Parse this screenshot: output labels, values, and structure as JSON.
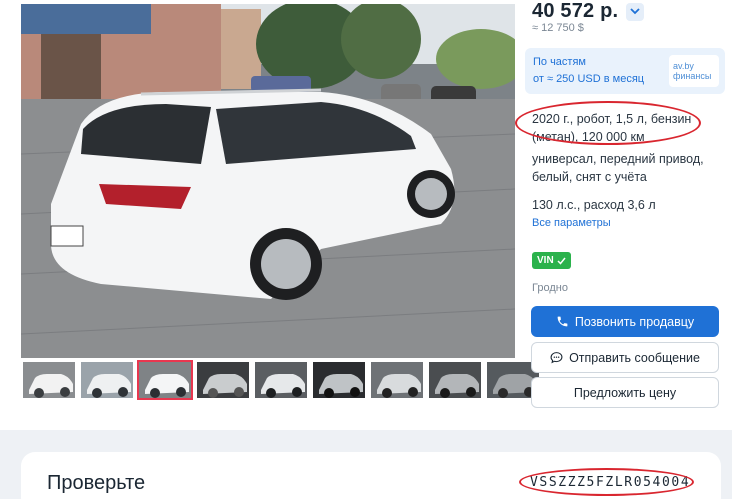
{
  "listing": {
    "price": "40 572 р.",
    "price_usd": "≈ 12 750 $",
    "finance": {
      "title": "По частям",
      "subtitle": "от ≈ 250 USD в месяц",
      "logo_line1": "av.by",
      "logo_line2": "финансы"
    },
    "specs": {
      "main": "2020 г., робот, 1,5 л, бензин (метан), 120 000 км",
      "body": "универсал, передний привод, белый, снят с учёта",
      "power": "130 л.с., расход 3,6 л"
    },
    "params_link": "Все параметры",
    "vin_badge": "VIN",
    "city": "Гродно"
  },
  "buttons": {
    "call": "Позвонить продавцу",
    "message": "Отправить сообщение",
    "offer": "Предложить цену"
  },
  "gallery": {
    "thumbnail_count": 9,
    "active_index": 2
  },
  "check": {
    "title": "Проверьте",
    "vin": "VSSZZZ5FZLR054004"
  },
  "colors": {
    "accent": "#1f71d6",
    "vin_green": "#2bb24c",
    "annotation": "#d9262f",
    "thumb_active": "#e8374f"
  }
}
